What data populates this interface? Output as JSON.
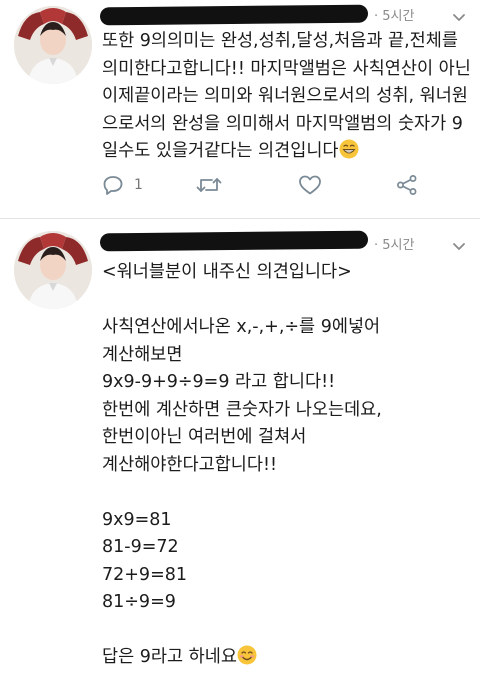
{
  "tweets": [
    {
      "time": "· 5시간",
      "text": "또한 9의의미는 완성,성취,달성,처음과 끝,전체를 의미한다고합니다!! 마지막앨범은 사칙연산이 아닌 이제끝이라는 의미와 워너원으로서의 성취, 워너원으로서의 완성을 의미해서 마지막앨범의 숫자가 9일수도 있을거같다는 의견입니다",
      "emoji": "grinning-face",
      "reply_count": "1"
    },
    {
      "time": "· 5시간",
      "text": "<워너블분이 내주신 의견입니다>\n\n사칙연산에서나온 x,-,+,÷를 9에넣어\n계산해보면\n9x9-9+9÷9=9 라고 합니다!!\n한번에 계산하면 큰숫자가 나오는데요,\n한번이아닌 여러번에 걸쳐서\n계산해야한다고합니다!!\n\n9x9=81\n81-9=72\n72+9=81\n81÷9=9\n\n답은 9라고 하네요",
      "emoji": "smiling-face"
    }
  ],
  "colors": {
    "meta": "#8a8a8a",
    "icon": "#7a8a96",
    "divider": "#e3e3e3"
  }
}
